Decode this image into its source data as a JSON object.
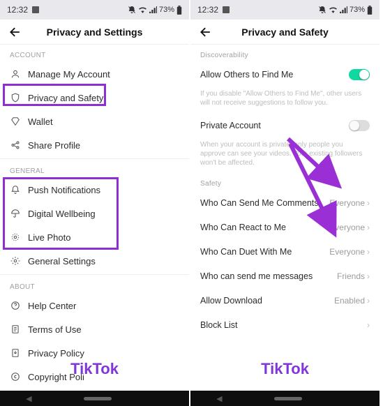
{
  "status": {
    "time": "12:32",
    "battery": "73%"
  },
  "left": {
    "title": "Privacy and Settings",
    "sections": {
      "account": {
        "label": "ACCOUNT",
        "items": [
          {
            "label": "Manage My Account"
          },
          {
            "label": "Privacy and Safety"
          },
          {
            "label": "Wallet"
          },
          {
            "label": "Share Profile"
          }
        ]
      },
      "general": {
        "label": "GENERAL",
        "items": [
          {
            "label": "Push Notifications"
          },
          {
            "label": "Digital Wellbeing"
          },
          {
            "label": "Live Photo"
          },
          {
            "label": "General Settings"
          }
        ]
      },
      "about": {
        "label": "ABOUT",
        "items": [
          {
            "label": "Help Center"
          },
          {
            "label": "Terms of Use"
          },
          {
            "label": "Privacy Policy"
          },
          {
            "label": "Copyright Poli"
          }
        ]
      }
    }
  },
  "right": {
    "title": "Privacy and Safety",
    "discoverability_label": "Discoverability",
    "allow_find": {
      "label": "Allow Others to Find Me",
      "desc": "If you disable \"Allow Others to Find Me\", other users will not receive suggestions to follow you.",
      "on": true
    },
    "private": {
      "label": "Private Account",
      "desc": "When your account is private, only people you approve can see your videos. Your existing followers won't be affected.",
      "on": false
    },
    "safety_label": "Safety",
    "safety": [
      {
        "label": "Who Can Send Me Comments",
        "value": "Everyone"
      },
      {
        "label": "Who Can React to Me",
        "value": "Everyone"
      },
      {
        "label": "Who Can Duet With Me",
        "value": "Everyone"
      },
      {
        "label": "Who can send me messages",
        "value": "Friends"
      },
      {
        "label": "Allow Download",
        "value": "Enabled"
      },
      {
        "label": "Block List",
        "value": ""
      }
    ]
  },
  "watermark": "TikTok"
}
